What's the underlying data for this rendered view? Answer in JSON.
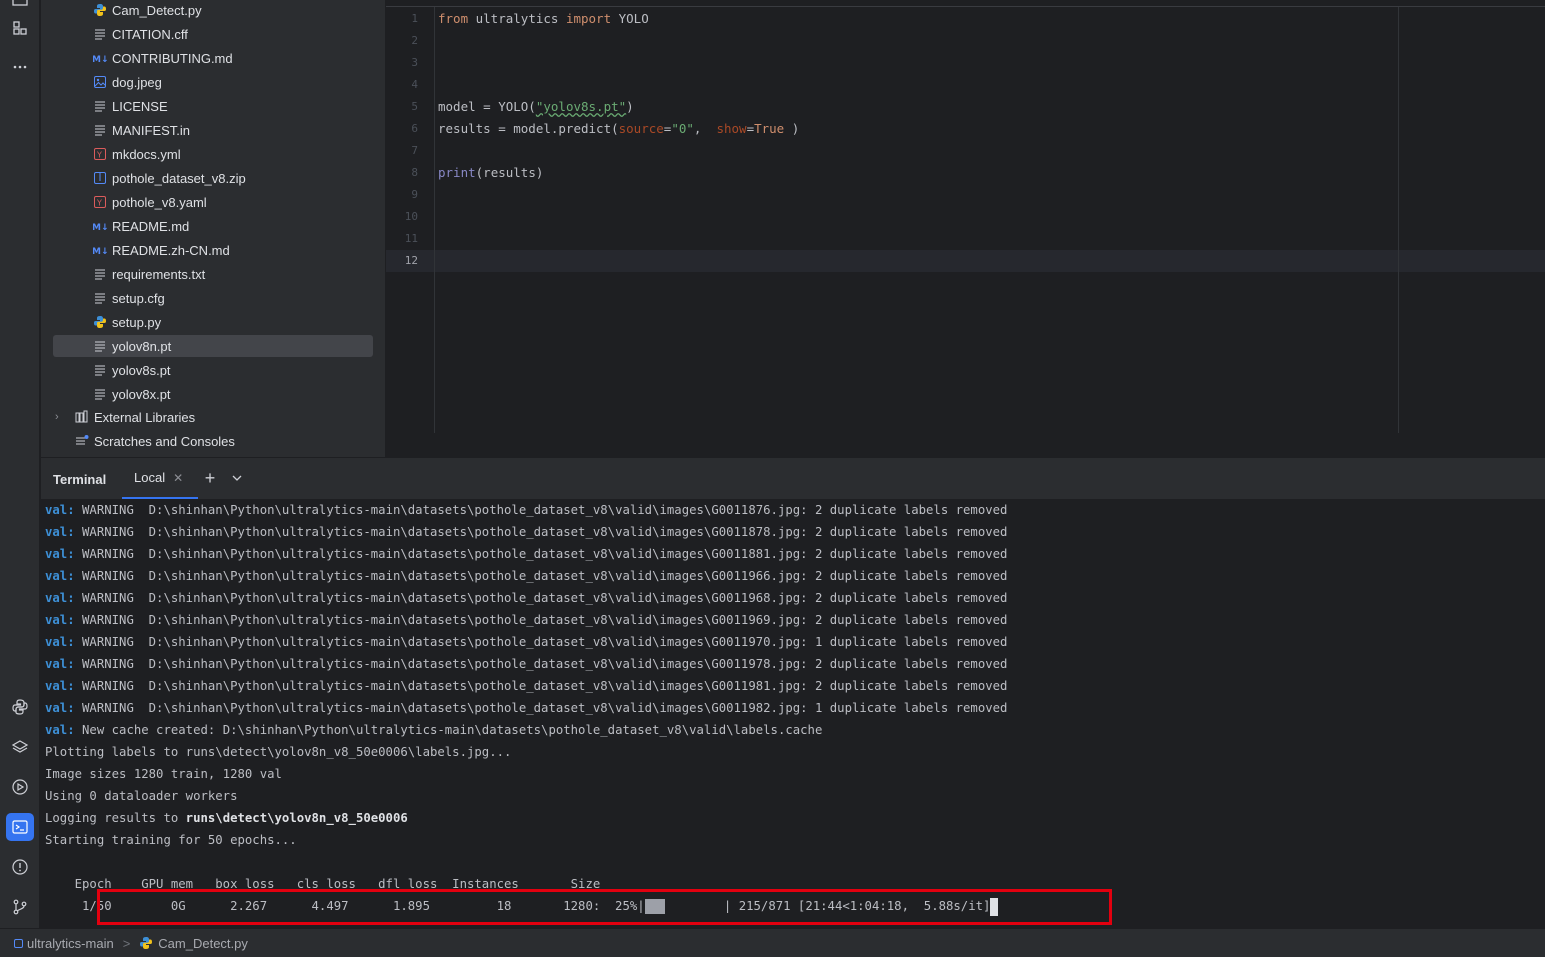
{
  "project_tree": {
    "items": [
      {
        "label": "Cam_Detect.py",
        "icon": "python-icon"
      },
      {
        "label": "CITATION.cff",
        "icon": "text-file-icon"
      },
      {
        "label": "CONTRIBUTING.md",
        "icon": "markdown-icon"
      },
      {
        "label": "dog.jpeg",
        "icon": "image-icon"
      },
      {
        "label": "LICENSE",
        "icon": "text-file-icon"
      },
      {
        "label": "MANIFEST.in",
        "icon": "text-file-icon"
      },
      {
        "label": "mkdocs.yml",
        "icon": "yaml-icon"
      },
      {
        "label": "pothole_dataset_v8.zip",
        "icon": "archive-icon"
      },
      {
        "label": "pothole_v8.yaml",
        "icon": "yaml-icon"
      },
      {
        "label": "README.md",
        "icon": "markdown-icon"
      },
      {
        "label": "README.zh-CN.md",
        "icon": "markdown-icon"
      },
      {
        "label": "requirements.txt",
        "icon": "text-file-icon"
      },
      {
        "label": "setup.cfg",
        "icon": "text-file-icon"
      },
      {
        "label": "setup.py",
        "icon": "python-icon"
      },
      {
        "label": "yolov8n.pt",
        "icon": "text-file-icon"
      },
      {
        "label": "yolov8s.pt",
        "icon": "text-file-icon"
      },
      {
        "label": "yolov8x.pt",
        "icon": "text-file-icon"
      }
    ],
    "external_libraries": "External Libraries",
    "scratches": "Scratches and Consoles",
    "selected": "yolov8n.pt"
  },
  "editor": {
    "line_numbers": [
      "1",
      "2",
      "3",
      "4",
      "5",
      "6",
      "7",
      "8",
      "9",
      "10",
      "11",
      "12"
    ],
    "current_line": "12",
    "code": {
      "l1_kw1": "from",
      "l1_mod": " ultralytics ",
      "l1_kw2": "import",
      "l1_cls": " YOLO",
      "l5_a": "model = YOLO(",
      "l5_str": "\"yolov8s.pt\"",
      "l5_b": ")",
      "l6_a": "results = model.predict(",
      "l6_p1": "source",
      "l6_eq1": "=",
      "l6_s1": "\"0\"",
      "l6_c": ",  ",
      "l6_p2": "show",
      "l6_eq2": "=",
      "l6_v2": "True",
      "l6_d": " )",
      "l8_fn": "print",
      "l8_rest": "(results)"
    }
  },
  "terminal": {
    "title": "Terminal",
    "tab": "Local",
    "lines": [
      {
        "prefix": "val:",
        "text": " WARNING  D:\\shinhan\\Python\\ultralytics-main\\datasets\\pothole_dataset_v8\\valid\\images\\G0011876.jpg: 2 duplicate labels removed"
      },
      {
        "prefix": "val:",
        "text": " WARNING  D:\\shinhan\\Python\\ultralytics-main\\datasets\\pothole_dataset_v8\\valid\\images\\G0011878.jpg: 2 duplicate labels removed"
      },
      {
        "prefix": "val:",
        "text": " WARNING  D:\\shinhan\\Python\\ultralytics-main\\datasets\\pothole_dataset_v8\\valid\\images\\G0011881.jpg: 2 duplicate labels removed"
      },
      {
        "prefix": "val:",
        "text": " WARNING  D:\\shinhan\\Python\\ultralytics-main\\datasets\\pothole_dataset_v8\\valid\\images\\G0011966.jpg: 2 duplicate labels removed"
      },
      {
        "prefix": "val:",
        "text": " WARNING  D:\\shinhan\\Python\\ultralytics-main\\datasets\\pothole_dataset_v8\\valid\\images\\G0011968.jpg: 2 duplicate labels removed"
      },
      {
        "prefix": "val:",
        "text": " WARNING  D:\\shinhan\\Python\\ultralytics-main\\datasets\\pothole_dataset_v8\\valid\\images\\G0011969.jpg: 2 duplicate labels removed"
      },
      {
        "prefix": "val:",
        "text": " WARNING  D:\\shinhan\\Python\\ultralytics-main\\datasets\\pothole_dataset_v8\\valid\\images\\G0011970.jpg: 1 duplicate labels removed"
      },
      {
        "prefix": "val:",
        "text": " WARNING  D:\\shinhan\\Python\\ultralytics-main\\datasets\\pothole_dataset_v8\\valid\\images\\G0011978.jpg: 2 duplicate labels removed"
      },
      {
        "prefix": "val:",
        "text": " WARNING  D:\\shinhan\\Python\\ultralytics-main\\datasets\\pothole_dataset_v8\\valid\\images\\G0011981.jpg: 2 duplicate labels removed"
      },
      {
        "prefix": "val:",
        "text": " WARNING  D:\\shinhan\\Python\\ultralytics-main\\datasets\\pothole_dataset_v8\\valid\\images\\G0011982.jpg: 1 duplicate labels removed"
      },
      {
        "prefix": "val:",
        "text": " New cache created: D:\\shinhan\\Python\\ultralytics-main\\datasets\\pothole_dataset_v8\\valid\\labels.cache"
      },
      {
        "prefix": "",
        "text": "Plotting labels to runs\\detect\\yolov8n_v8_50e0006\\labels.jpg..."
      },
      {
        "prefix": "",
        "text": "Image sizes 1280 train, 1280 val"
      },
      {
        "prefix": "",
        "text": "Using 0 dataloader workers"
      },
      {
        "prefix": "",
        "text": "Logging results to "
      },
      {
        "prefix": "",
        "text": "Starting training for 50 epochs..."
      }
    ],
    "log_dir_bold": "runs\\detect\\yolov8n_v8_50e0006",
    "table_header": "    Epoch    GPU_mem   box_loss   cls_loss   dfl_loss  Instances       Size",
    "progress_left": "     1/50        0G      2.267      4.497      1.895         18       1280:  25%|",
    "progress_right": "        | 215/871 [21:44<1:04:18,  5.88s/it]",
    "progress_fraction": 0.25
  },
  "statusbar": {
    "project": "ultralytics-main",
    "file": "Cam_Detect.py",
    "separator": ">"
  },
  "colors": {
    "accent": "#3574f0",
    "highlight_box": "#e3000f"
  }
}
